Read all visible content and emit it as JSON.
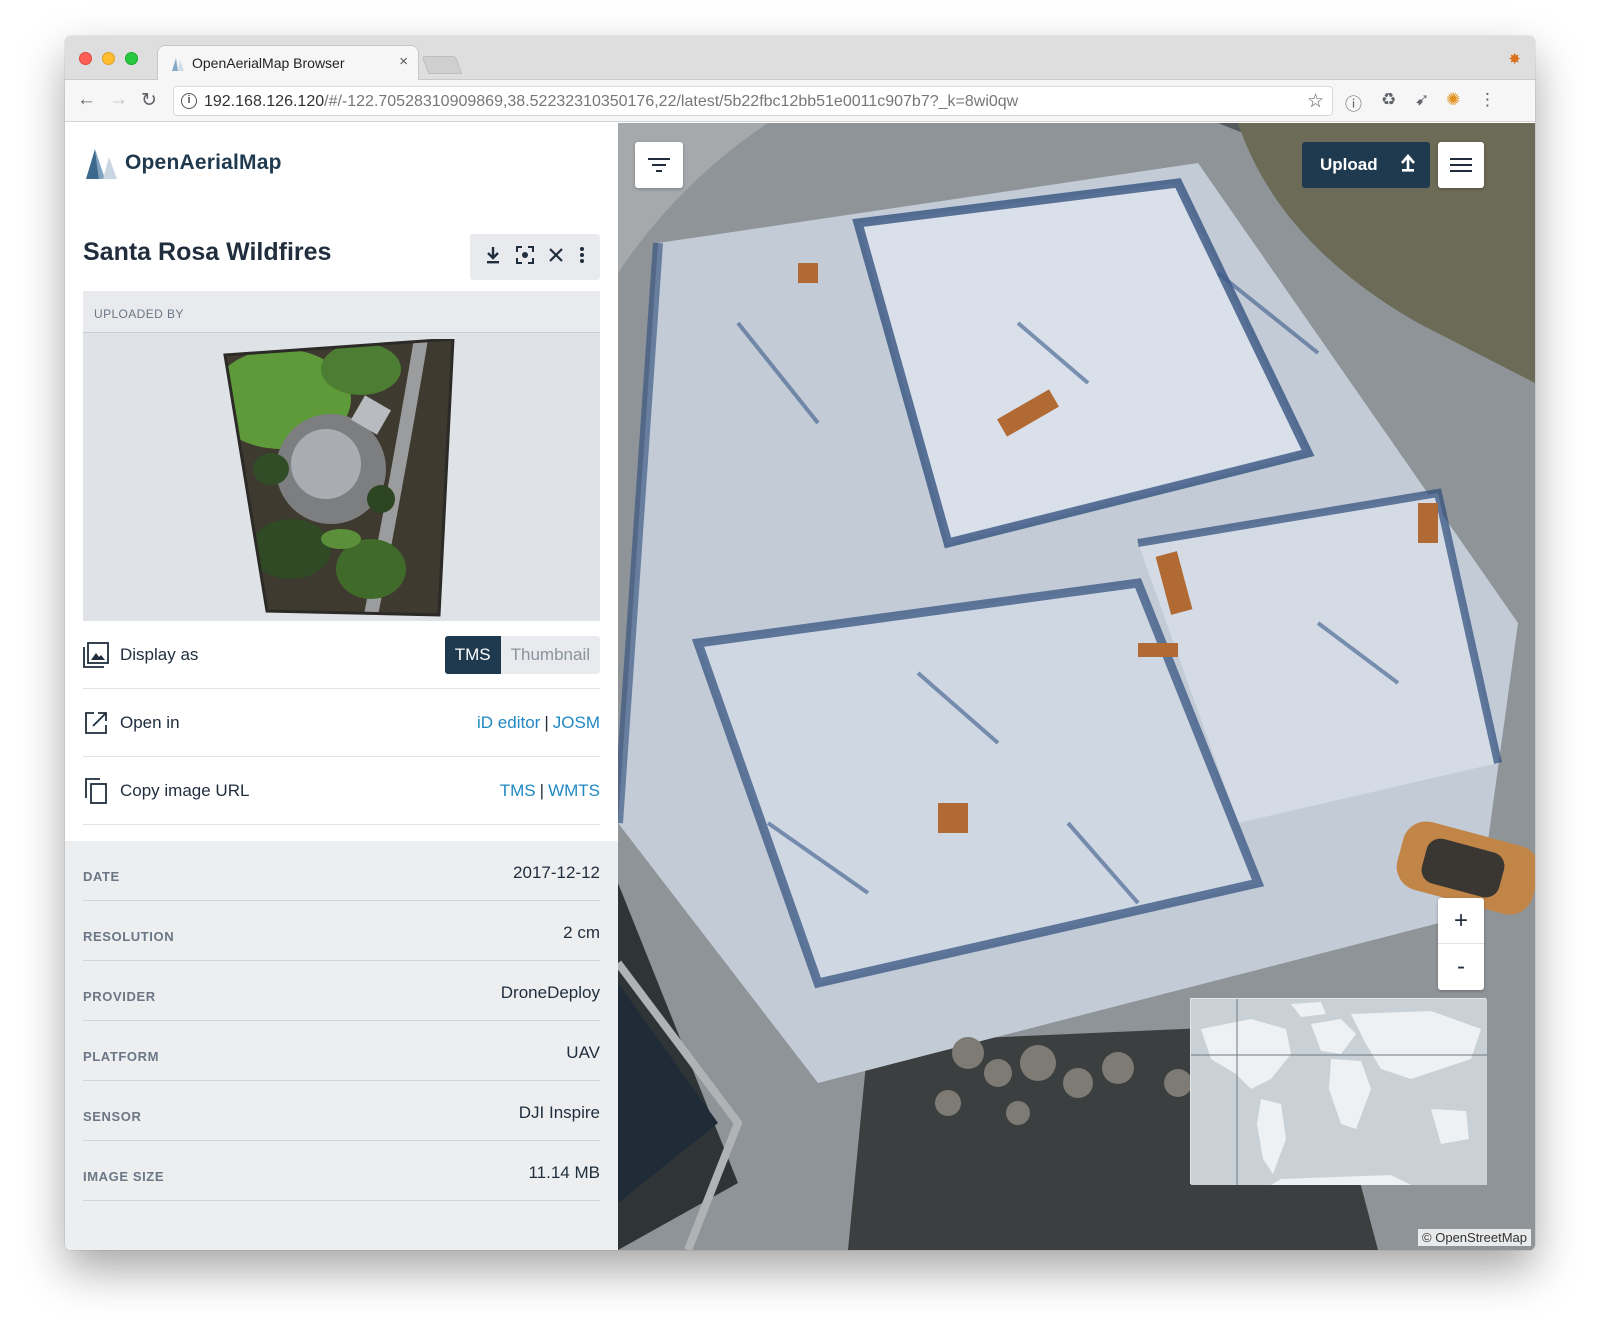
{
  "browser": {
    "tab_title": "OpenAerialMap Browser",
    "tab_close": "×",
    "url_host": "192.168.126.120",
    "url_path": "/#/-122.70528310909869,38.52232310350176,22/latest/5b22fbc12bb51e0011c907b7?_k=8wi0qw"
  },
  "sidebar": {
    "brand": "OpenAerialMap",
    "title": "Santa Rosa Wildfires",
    "uploaded_by_label": "UPLOADED BY",
    "display_as_label": "Display as",
    "display_options": [
      "TMS",
      "Thumbnail"
    ],
    "selected_display": "TMS",
    "open_in_label": "Open in",
    "open_in_links": [
      "iD editor",
      "JOSM"
    ],
    "copy_url_label": "Copy image URL",
    "copy_url_links": [
      "TMS",
      "WMTS"
    ],
    "link_separator": "|"
  },
  "metadata": [
    {
      "key": "DATE",
      "value": "2017-12-12"
    },
    {
      "key": "RESOLUTION",
      "value": "2 cm"
    },
    {
      "key": "PROVIDER",
      "value": "DroneDeploy"
    },
    {
      "key": "PLATFORM",
      "value": "UAV"
    },
    {
      "key": "SENSOR",
      "value": "DJI Inspire"
    },
    {
      "key": "IMAGE SIZE",
      "value": "11.14 MB"
    }
  ],
  "map": {
    "upload_label": "Upload",
    "zoom_in": "+",
    "zoom_out": "-",
    "attribution": "© OpenStreetMap"
  },
  "colors": {
    "accent_dark": "#1f3a4f",
    "link_blue": "#2088c3"
  }
}
